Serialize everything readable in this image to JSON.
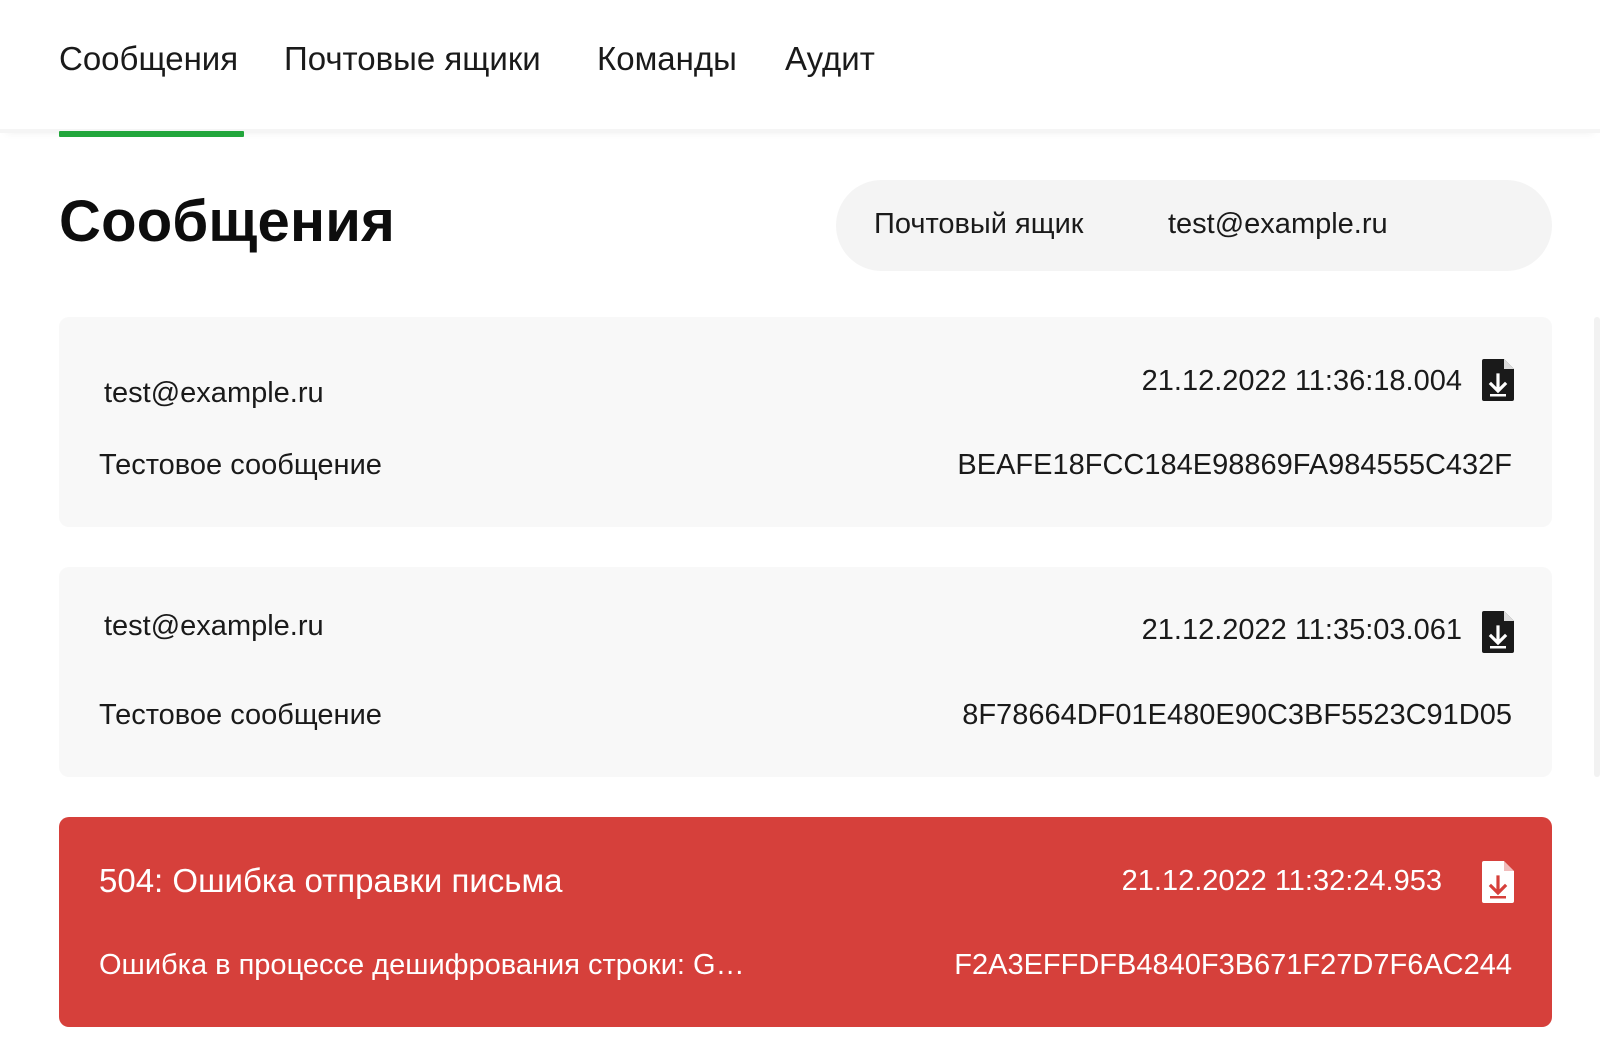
{
  "nav": {
    "tabs": [
      {
        "label": "Сообщения",
        "active": true
      },
      {
        "label": "Почтовые ящики",
        "active": false
      },
      {
        "label": "Команды",
        "active": false
      },
      {
        "label": "Аудит",
        "active": false
      }
    ]
  },
  "page": {
    "title": "Сообщения"
  },
  "filter": {
    "label": "Почтовый ящик",
    "value": "test@example.ru"
  },
  "messages": [
    {
      "sender": "test@example.ru",
      "subject": "Тестовое сообщение",
      "timestamp": "21.12.2022 11:36:18.004",
      "id": "BEAFE18FCC184E98869FA984555C432F",
      "status": "ok",
      "icon": "file-download-icon"
    },
    {
      "sender": "test@example.ru",
      "subject": "Тестовое сообщение",
      "timestamp": "21.12.2022 11:35:03.061",
      "id": "8F78664DF01E480E90C3BF5523C91D05",
      "status": "ok",
      "icon": "file-download-icon"
    },
    {
      "error_title": "504: Ошибка отправки письма",
      "subject": "Ошибка в процессе дешифрования строки: G…",
      "timestamp": "21.12.2022 11:32:24.953",
      "id": "F2A3EFFDFB4840F3B671F27D7F6AC244",
      "status": "error",
      "icon": "file-download-icon"
    }
  ],
  "colors": {
    "accent": "#22a63c",
    "card_bg": "#f8f8f8",
    "error_bg": "#d6403b",
    "text": "#1a1a1a"
  }
}
